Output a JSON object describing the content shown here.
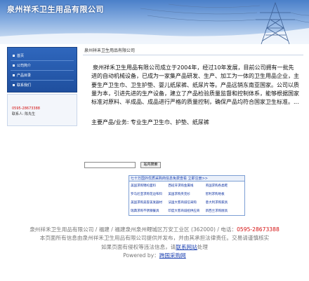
{
  "banner": {
    "title": "泉州祥禾卫生用品有限公司"
  },
  "sidebar": {
    "menu": [
      {
        "label": "首页"
      },
      {
        "label": "公司简介"
      },
      {
        "label": "产品目录"
      },
      {
        "label": "联系我们"
      }
    ],
    "contact": {
      "phone": "0595-28673388",
      "person": "联系人: 陈先生"
    }
  },
  "main": {
    "breadcrumb": "泉州祥禾卫生用品有限公司",
    "intro": "泉州祥禾卫生用品有限公司成立于2004年，经过10年发展，目前公司拥有一批先进的自动机械设备，已成为一家集产品研发、生产、加工为一体的卫生用品企业，主要生产卫生巾、卫生护垫、婴儿纸尿裤、纸尿片等。产品远销东南亚国家。公司以质量为本，引进先进的生产设备，建立了产品检验质量监督和控制体系，能够根据国家标准对原料、半成品、成品进行严格的质量控制，确保产品均符合国家卫生标准。...",
    "products": "主要产品/业务: 专业生产卫生巾、护垫、纸尿裤"
  },
  "search": {
    "placeholder": "",
    "button": "站内搜索"
  },
  "links": {
    "header": "七十万国外优质采购商信息免费查看 立即注册>>",
    "items": [
      "美国求购锦纶面料",
      "西班牙求购金属线",
      "英国求购各类鞋",
      "罗马尼亚求购花边布料",
      "美国求购夹克衫",
      "智利求购地板",
      "美国求购美容美发器材",
      "法国大客商诚信采购",
      "意大利求购家具",
      "瑞典求购不锈钢餐具",
      "印度大客商诚招供应商",
      "新西兰求购厨具"
    ]
  },
  "footer": {
    "line1_prefix": "泉州祥禾卫生用品有限公司 / 福建 / 福建泉州泉州鲤城区万安工业区 (362000) / 电话：",
    "phone": "0595-28673388",
    "line2": "本页面所有信息由泉州祥禾卫生用品有限公司提供并发布，并由其承担法律责任。交易请谨慎核实",
    "line3_prefix": "如果页面有侵权等违法信息，请",
    "line3_link": "联系网站",
    "line3_suffix": "处理",
    "powered_prefix": "Powered by：",
    "powered_link": "跨国采购网"
  },
  "colors": {
    "accent": "#1f4f9e",
    "phone": "#d41010",
    "link": "#1a3fb0"
  }
}
